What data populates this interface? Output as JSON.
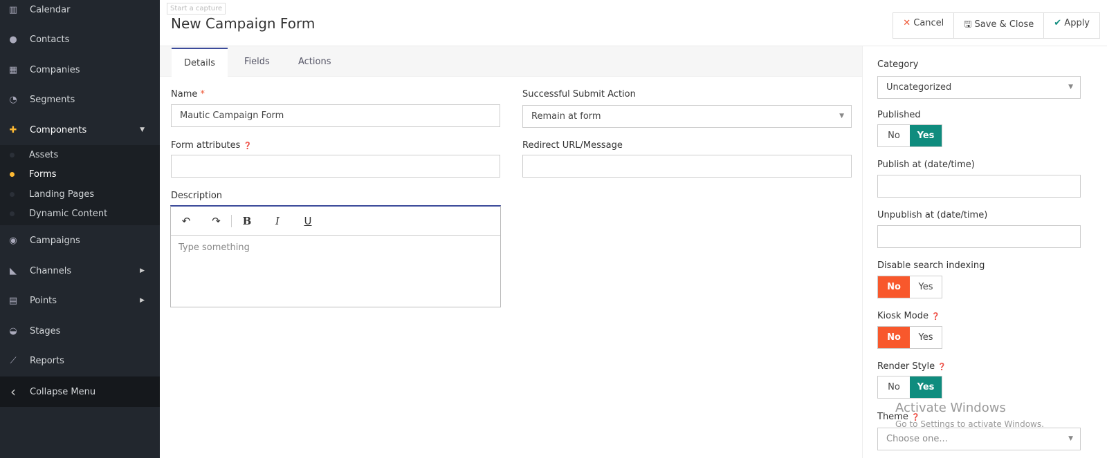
{
  "sidebar": {
    "items": [
      {
        "label": "Calendar",
        "icon": "calendar-icon",
        "glyph": "▥"
      },
      {
        "label": "Contacts",
        "icon": "user-icon",
        "glyph": "●"
      },
      {
        "label": "Companies",
        "icon": "building-icon",
        "glyph": "▦"
      },
      {
        "label": "Segments",
        "icon": "pie-chart-icon",
        "glyph": "◔"
      },
      {
        "label": "Components",
        "icon": "puzzle-icon",
        "glyph": "✚"
      },
      {
        "label": "Campaigns",
        "icon": "clock-icon",
        "glyph": "◉"
      },
      {
        "label": "Channels",
        "icon": "rss-icon",
        "glyph": "◣"
      },
      {
        "label": "Points",
        "icon": "calculator-icon",
        "glyph": "▤"
      },
      {
        "label": "Stages",
        "icon": "dashboard-icon",
        "glyph": "◒"
      },
      {
        "label": "Reports",
        "icon": "line-chart-icon",
        "glyph": "⟋"
      },
      {
        "label": "Collapse Menu",
        "icon": "chevron-left-icon",
        "glyph": "‹"
      }
    ],
    "sub_items": [
      "Assets",
      "Forms",
      "Landing Pages",
      "Dynamic Content"
    ]
  },
  "header": {
    "capture": "Start a capture",
    "title": "New Campaign Form",
    "cancel": "Cancel",
    "save_close": "Save & Close",
    "apply": "Apply"
  },
  "tabs": [
    "Details",
    "Fields",
    "Actions"
  ],
  "form": {
    "name_label": "Name",
    "required": "*",
    "name_value": "Mautic Campaign Form",
    "submit_action_label": "Successful Submit Action",
    "submit_action_value": "Remain at form",
    "form_attr_label": "Form attributes",
    "redirect_label": "Redirect URL/Message",
    "description_label": "Description",
    "description_placeholder": "Type something",
    "toolbar": {
      "undo": "↶",
      "redo": "↷",
      "bold": "B",
      "italic": "I",
      "underline": "U"
    }
  },
  "right": {
    "category_label": "Category",
    "category_value": "Uncategorized",
    "published_label": "Published",
    "publish_at_label": "Publish at (date/time)",
    "unpublish_at_label": "Unpublish at (date/time)",
    "disable_search_label": "Disable search indexing",
    "kiosk_label": "Kiosk Mode",
    "render_label": "Render Style",
    "theme_label": "Theme",
    "theme_placeholder": "Choose one...",
    "no": "No",
    "yes": "Yes"
  },
  "watermark": {
    "title": "Activate Windows",
    "subtitle": "Go to Settings to activate Windows."
  },
  "colors": {
    "teal": "#0f8c7e",
    "orange": "#f8582c",
    "sidebar": "#22272e",
    "accent": "#fdb933"
  }
}
